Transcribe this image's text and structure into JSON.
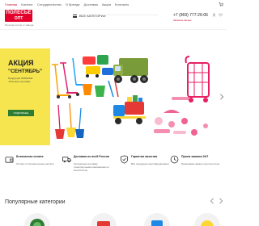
{
  "nav": {
    "items": [
      "Главная",
      "Каталог",
      "Сотрудничество",
      "О бренде",
      "Доставка",
      "Акции",
      "Контакты"
    ]
  },
  "header": {
    "logo_line1": "ПОЛЕСЬЕ",
    "logo_line2": "ОПТ",
    "logo_tagline": "Игрушки оптом от завода",
    "catalog_label": "ВСЕ КАТЕГОРИИ",
    "phone": "+7 (969) 777-26-06",
    "phone_sub": "Заказать звонок"
  },
  "banner": {
    "title_line1": "АКЦИЯ",
    "title_line2": "\"СЕНТЯБРЬ\"",
    "desc_line1": "Продукция ПОЛЕСЬЕ",
    "desc_line2": "-10% весь сентябрь",
    "button": "ПОДРОБНЕЕ"
  },
  "features": [
    {
      "title": "Безопасная оплата",
      "desc": "Оплата по безналичному расчёту"
    },
    {
      "title": "Доставка по всей России",
      "desc": "Организуем доставку транспортными компаниями по всей России"
    },
    {
      "title": "Гарантия качества",
      "desc": "Вся продукция сертифицирована"
    },
    {
      "title": "Прием заказов 24/7",
      "desc": "Принимаем заказы круглосуточно"
    }
  ],
  "categories": {
    "title": "Популярные категории"
  },
  "colors": {
    "brand_red": "#e4002b",
    "banner_yellow": "#f6e54f",
    "button_green": "#2e7d32",
    "accent_red": "#c8102e"
  },
  "icons": [
    "cart-icon",
    "menu-icon",
    "user-icon",
    "heart-icon",
    "chevron-right-icon",
    "wallet-icon",
    "truck-icon",
    "shield-icon",
    "clock-icon",
    "chevron-left-icon"
  ]
}
